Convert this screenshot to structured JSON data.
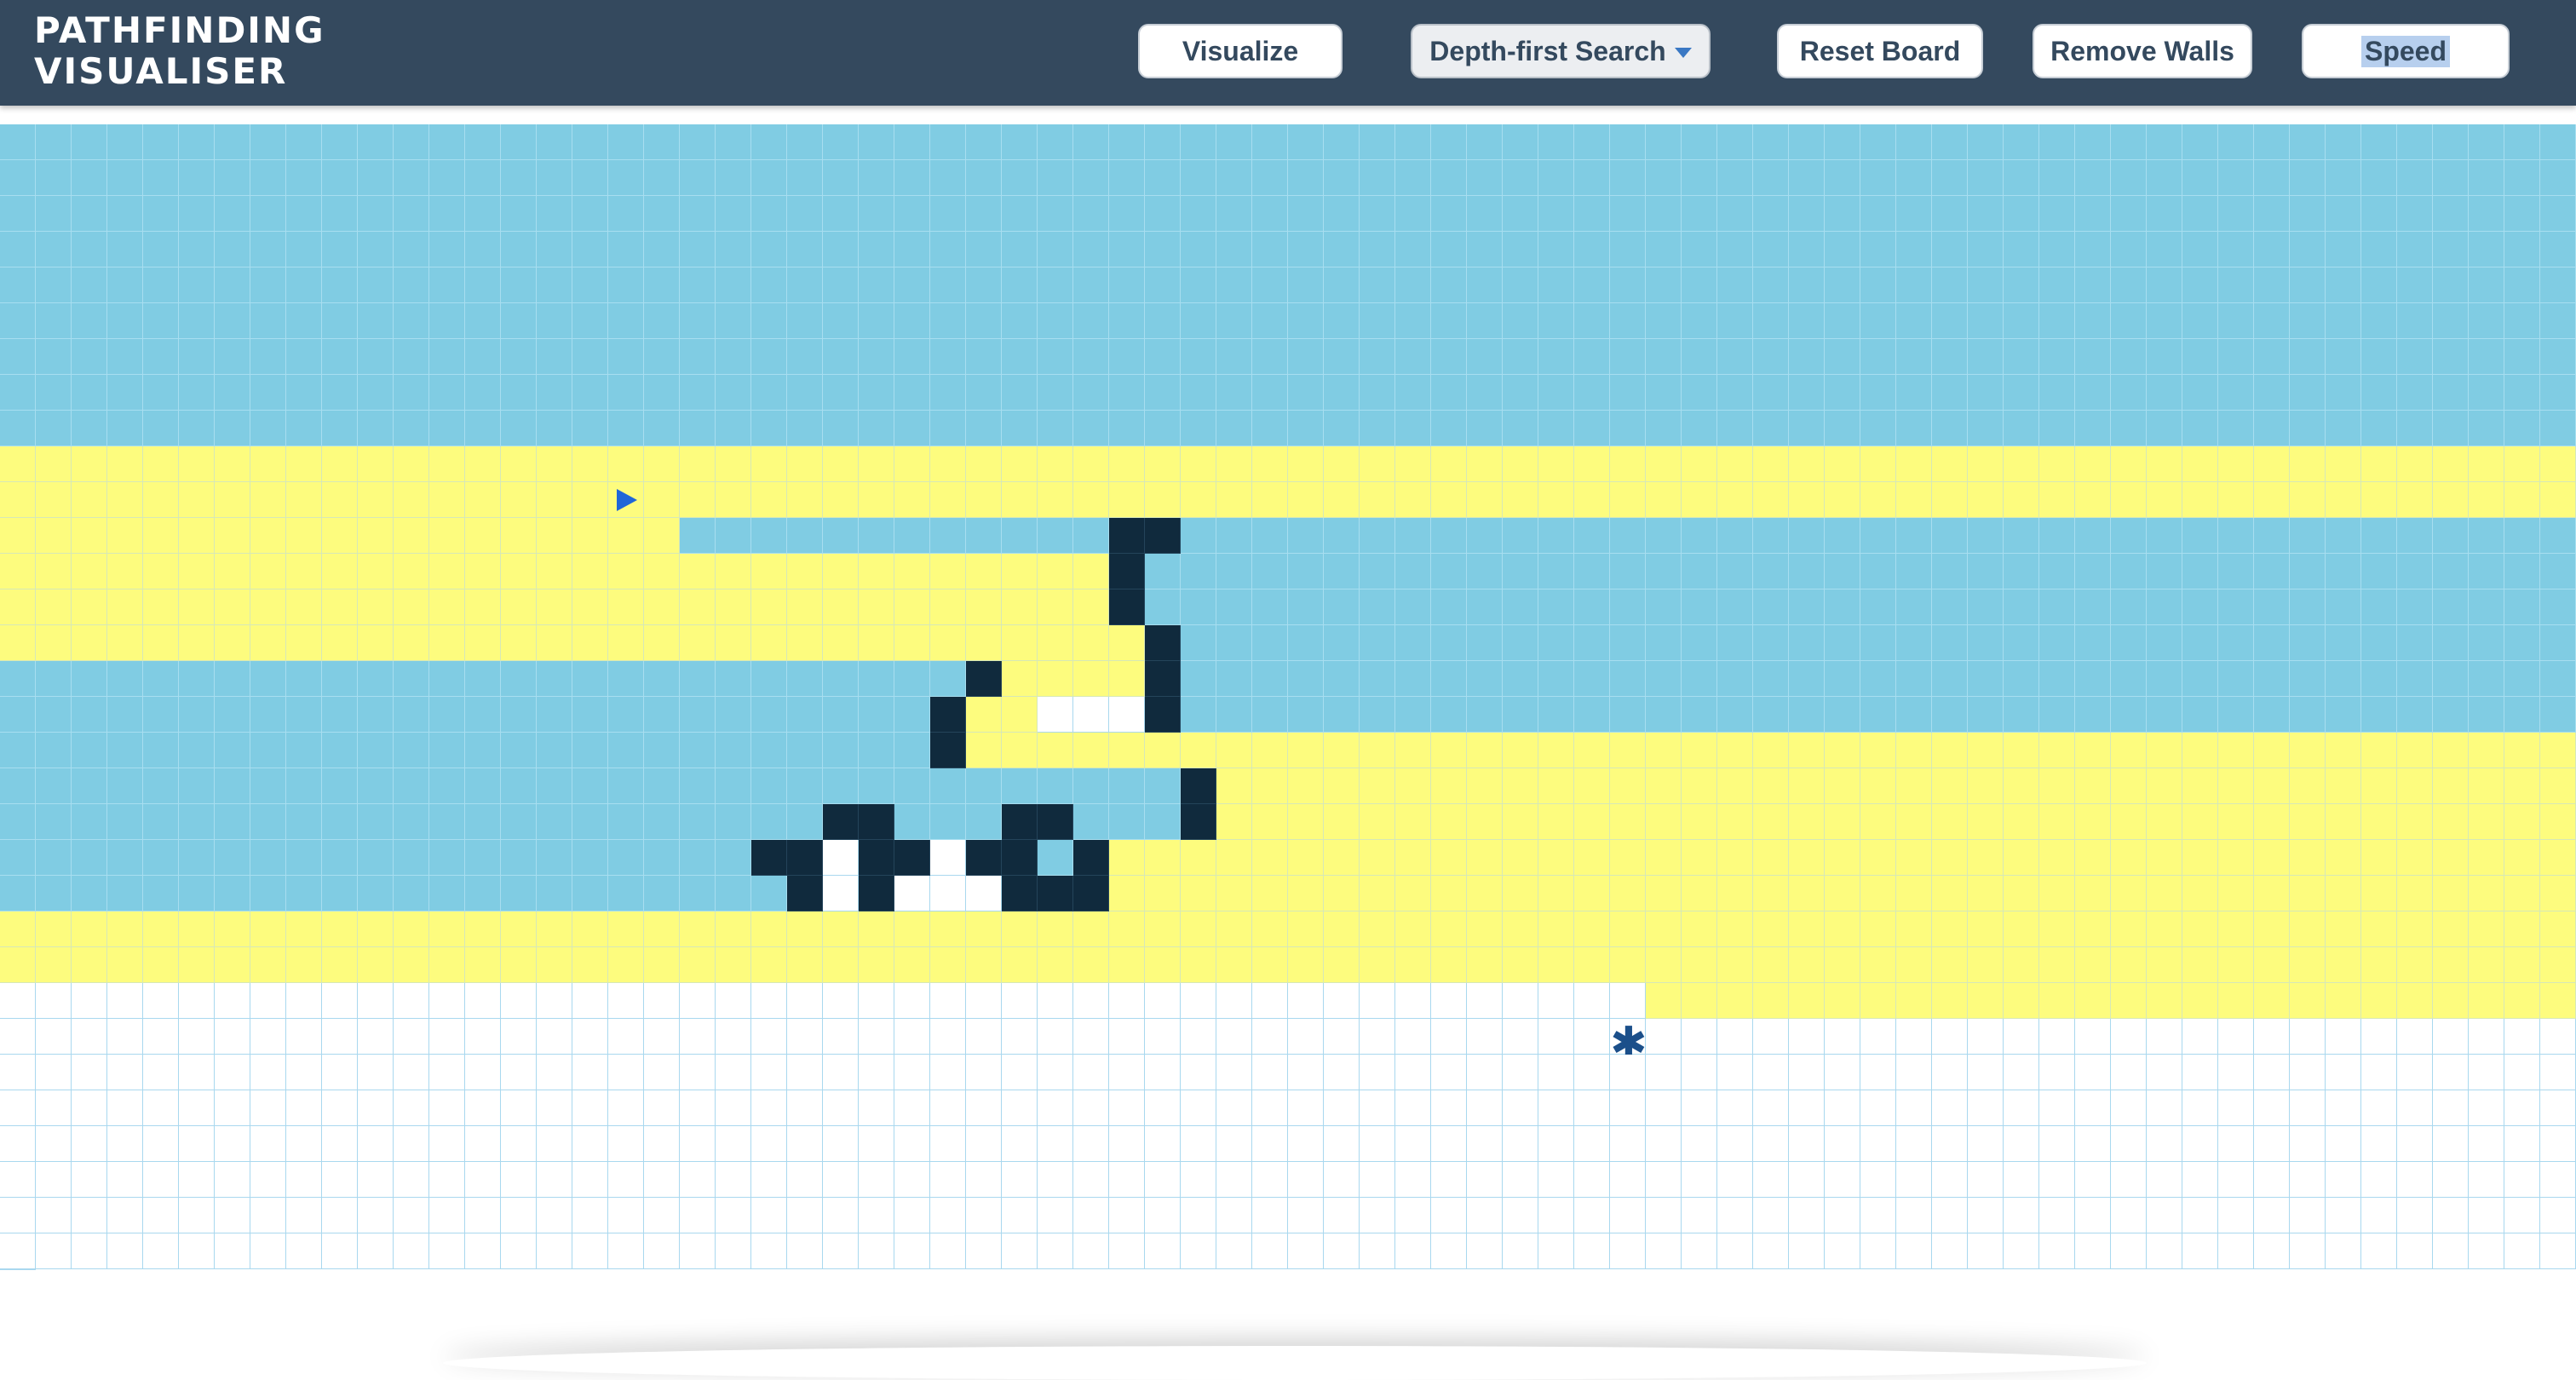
{
  "app": {
    "logo_line1": "PATHFINDING",
    "logo_line2": "VISUALISER"
  },
  "toolbar": {
    "visualize_label": "Visualize",
    "algorithm_selected": "Depth-first Search",
    "reset_label": "Reset Board",
    "remove_walls_label": "Remove Walls",
    "speed_label": "Speed"
  },
  "colors": {
    "navbar": "#34495e",
    "visited": "#80cce3",
    "path": "#fdfc7e",
    "wall": "#102a3d",
    "empty": "#ffffff",
    "start": "#1f66d8",
    "target": "#1b4f8a"
  },
  "grid": {
    "rows": 32,
    "cols": 72,
    "legend": {
      "V": "visited",
      "P": "path",
      "W": "wall",
      "E": "empty",
      "S": "start",
      "T": "target"
    },
    "cells": [
      "VVVVVVVVVVVVVVVVVVVVVVVVVVVVVVVVVVVVVVVVVVVVVVVVVVVVVVVVVVVVVVVVVVVVVVVV",
      "VVVVVVVVVVVVVVVVVVVVVVVVVVVVVVVVVVVVVVVVVVVVVVVVVVVVVVVVVVVVVVVVVVVVVVVV",
      "VVVVVVVVVVVVVVVVVVVVVVVVVVVVVVVVVVVVVVVVVVVVVVVVVVVVVVVVVVVVVVVVVVVVVVVV",
      "VVVVVVVVVVVVVVVVVVVVVVVVVVVVVVVVVVVVVVVVVVVVVVVVVVVVVVVVVVVVVVVVVVVVVVVV",
      "VVVVVVVVVVVVVVVVVVVVVVVVVVVVVVVVVVVVVVVVVVVVVVVVVVVVVVVVVVVVVVVVVVVVVVVV",
      "VVVVVVVVVVVVVVVVVVVVVVVVVVVVVVVVVVVVVVVVVVVVVVVVVVVVVVVVVVVVVVVVVVVVVVVV",
      "VVVVVVVVVVVVVVVVVVVVVVVVVVVVVVVVVVVVVVVVVVVVVVVVVVVVVVVVVVVVVVVVVVVVVVVV",
      "VVVVVVVVVVVVVVVVVVVVVVVVVVVVVVVVVVVVVVVVVVVVVVVVVVVVVVVVVVVVVVVVVVVVVVVV",
      "VVVVVVVVVVVVVVVVVVVVVVVVVVVVVVVVVVVVVVVVVVVVVVVVVVVVVVVVVVVVVVVVVVVVVVVV",
      "PPPPPPPPPPPPPPPPPPPPPPPPPPPPPPPPPPPPPPPPPPPPPPPPPPPPPPPPPPPPPPPPPPPPPPPP",
      "PPPPPPPPPPPPPPPPPSPPPPPPPPPPPPPPPPPPPPPPPPPPPPPPPPPPPPPPPPPPPPPPPPPPPPPP",
      "PPPPPPPPPPPPPPPPPPPVVVVVVVVVVVVWWVVVVVVVVVVVVVVVVVVVVVVVVVVVVVVVVVVVVVVV",
      "PPPPPPPPPPPPPPPPPPPPPPPPPPPPPPPWVVVVVVVVVVVVVVVVVVVVVVVVVVVVVVVVVVVVVVVV",
      "PPPPPPPPPPPPPPPPPPPPPPPPPPPPPPPWVVVVVVVVVVVVVVVVVVVVVVVVVVVVVVVVVVVVVVVV",
      "PPPPPPPPPPPPPPPPPPPPPPPPPPPPPPPPWVVVVVVVVVVVVVVVVVVVVVVVVVVVVVVVVVVVVVVV",
      "VVVVVVVVVVVVVVVVVVVVVVVVVVVWPPPPWVVVVVVVVVVVVVVVVVVVVVVVVVVVVVVVVVVVVVVV",
      "VVVVVVVVVVVVVVVVVVVVVVVVVVWPPEEEWVVVVVVVVVVVVVVVVVVVVVVVVVVVVVVVVVVVVVVV",
      "VVVVVVVVVVVVVVVVVVVVVVVVVVWPPPPPPPPPPPPPPPPPPPPPPPPPPPPPPPPPPPPPPPPPPPPP",
      "VVVVVVVVVVVVVVVVVVVVVVVVVVVVVVVVVWPPPPPPPPPPPPPPPPPPPPPPPPPPPPPPPPPPPPPP",
      "VVVVVVVVVVVVVVVVVVVVVVVWWVVVWWVVVWPPPPPPPPPPPPPPPPPPPPPPPPPPPPPPPPPPPPPP",
      "VVVVVVVVVVVVVVVVVVVVVWWEWWEWWVWPPPPPPPPPPPPPPPPPPPPPPPPPPPPPPPPPPPPPPPPP",
      "VVVVVVVVVVVVVVVVVVVVVVWEWEEEWWWPPPPPPPPPPPPPPPPPPPPPPPPPPPPPPPPPPPPPPPPP",
      "PPPPPPPPPPPPPPPPPPPPPPPPPPPPPPPPPPPPPPPPPPPPPPPPPPPPPPPPPPPPPPPPPPPPPPPP",
      "PPPPPPPPPPPPPPPPPPPPPPPPPPPPPPPPPPPPPPPPPPPPPPPPPPPPPPPPPPPPPPPPPPPPPPPP",
      "EEEEEEEEEEEEEEEEEEEEEEEEEEEEEEEEEEEEEEEEEEEEEEPPPPPPPPPPPPPPPPPPPPPPPPPP",
      "EEEEEEEEEEEEEEEEEEEEEEEEEEEEEEEEEEEEEEEEEEEEETEEEEEEEEEEEEEEEEEEEEEEEEEEE",
      "EEEEEEEEEEEEEEEEEEEEEEEEEEEEEEEEEEEEEEEEEEEEEEEEEEEEEEEEEEEEEEEEEEEEEEEE",
      "EEEEEEEEEEEEEEEEEEEEEEEEEEEEEEEEEEEEEEEEEEEEEEEEEEEEEEEEEEEEEEEEEEEEEEEE",
      "EEEEEEEEEEEEEEEEEEEEEEEEEEEEEEEEEEEEEEEEEEEEEEEEEEEEEEEEEEEEEEEEEEEEEEEE",
      "EEEEEEEEEEEEEEEEEEEEEEEEEEEEEEEEEEEEEEEEEEEEEEEEEEEEEEEEEEEEEEEEEEEEEEEE",
      "EEEEEEEEEEEEEEEEEEEEEEEEEEEEEEEEEEEEEEEEEEEEEEEEEEEEEEEEEEEEEEEEEEEEEEEE",
      "EEEEEEEEEEEEEEEEEEEEEEEEEEEEEEEEEEEEEEEEEEEEEEEEEEEEEEEEEEEEEEEEEEEEEEEE"
    ],
    "start_icon": "triangle-right-icon",
    "target_icon": "asterisk-icon",
    "target_glyph": "✱"
  }
}
